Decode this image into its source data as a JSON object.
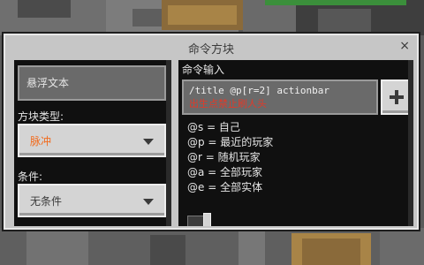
{
  "window": {
    "title": "命令方块",
    "close_glyph": "×"
  },
  "left_panel": {
    "hover_text_placeholder": "悬浮文本",
    "block_type_label": "方块类型:",
    "block_type_value": "脉冲",
    "block_type_color": "#f26b1d",
    "condition_label": "条件:",
    "condition_value": "无条件"
  },
  "right_panel": {
    "command_input_label": "命令输入",
    "command_line1": "/title @p[r=2] actionbar",
    "command_line2": "出生点禁止刷人头",
    "command_error_color": "#e03a2a",
    "add_button_icon": "plus-icon",
    "selectors": [
      "@s = 自己",
      "@p = 最近的玩家",
      "@r = 随机玩家",
      "@a = 全部玩家",
      "@e = 全部实体"
    ]
  }
}
